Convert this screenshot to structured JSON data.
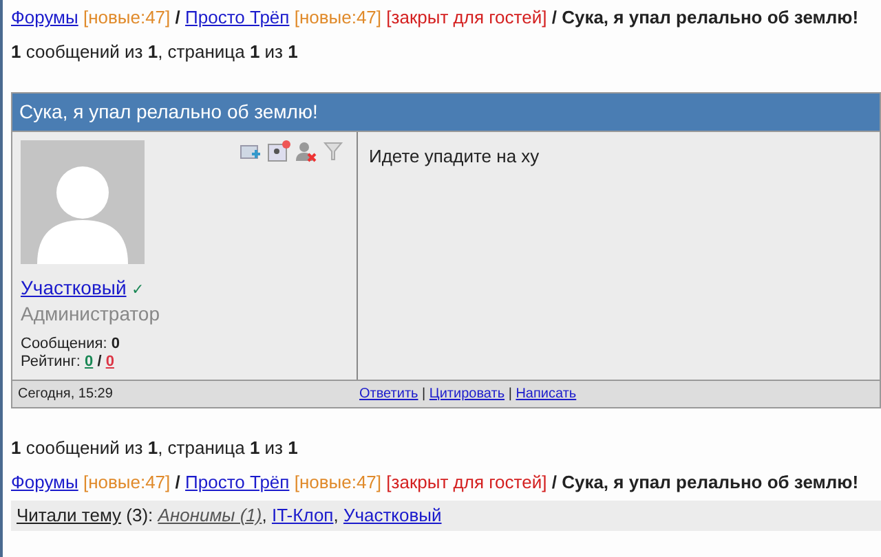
{
  "breadcrumb_top": [
    {
      "kind": "link",
      "text": "Форумы"
    },
    {
      "kind": "new",
      "text": "[новые:47]"
    },
    {
      "kind": "sep",
      "text": "/"
    },
    {
      "kind": "link",
      "text": "Просто Трёп"
    },
    {
      "kind": "new",
      "text": "[новые:47]"
    },
    {
      "kind": "closed",
      "text": "[закрыт для гостей]"
    },
    {
      "kind": "sep",
      "text": "/"
    },
    {
      "kind": "current",
      "text": "Сука, я упал релально об землю!"
    }
  ],
  "pagination_top": "**1** сообщений из **1**, страница **1** из **1**",
  "post": {
    "title": "Сука, я упал релально об землю!",
    "username": "Участковый",
    "verified": true,
    "check_mark": "✓",
    "rating_separator": "/",
    "action_separator": "|",
    "role": "Администратор",
    "messages_label": "Сообщения:",
    "messages_value": "0",
    "rating_label": "Рейтинг:",
    "rating_plus": "0",
    "rating_minus": "0",
    "body": "Идете упадите на ху",
    "date": "Сегодня, 15:29",
    "actions": [
      "Ответить",
      "Цитировать",
      "Написать"
    ]
  },
  "pagination_bottom": "**1** сообщений из **1**, страница **1** из **1**",
  "breadcrumb_bottom": [
    {
      "kind": "link",
      "text": "Форумы"
    },
    {
      "kind": "new",
      "text": "[новые:47]"
    },
    {
      "kind": "sep",
      "text": "/"
    },
    {
      "kind": "link",
      "text": "Просто Трёп"
    },
    {
      "kind": "new",
      "text": "[новые:47]"
    },
    {
      "kind": "closed",
      "text": "[закрыт для гостей]"
    },
    {
      "kind": "sep",
      "text": "/"
    },
    {
      "kind": "current",
      "text": "Сука, я упал релально об землю!"
    }
  ],
  "readers": {
    "label": "Читали тему",
    "count": "(3):",
    "separator": ",",
    "items": [
      {
        "kind": "anon",
        "text": "Анонимы (1)"
      },
      {
        "kind": "user",
        "text": "IT-Клоп"
      },
      {
        "kind": "user",
        "text": "Участковый"
      }
    ]
  }
}
